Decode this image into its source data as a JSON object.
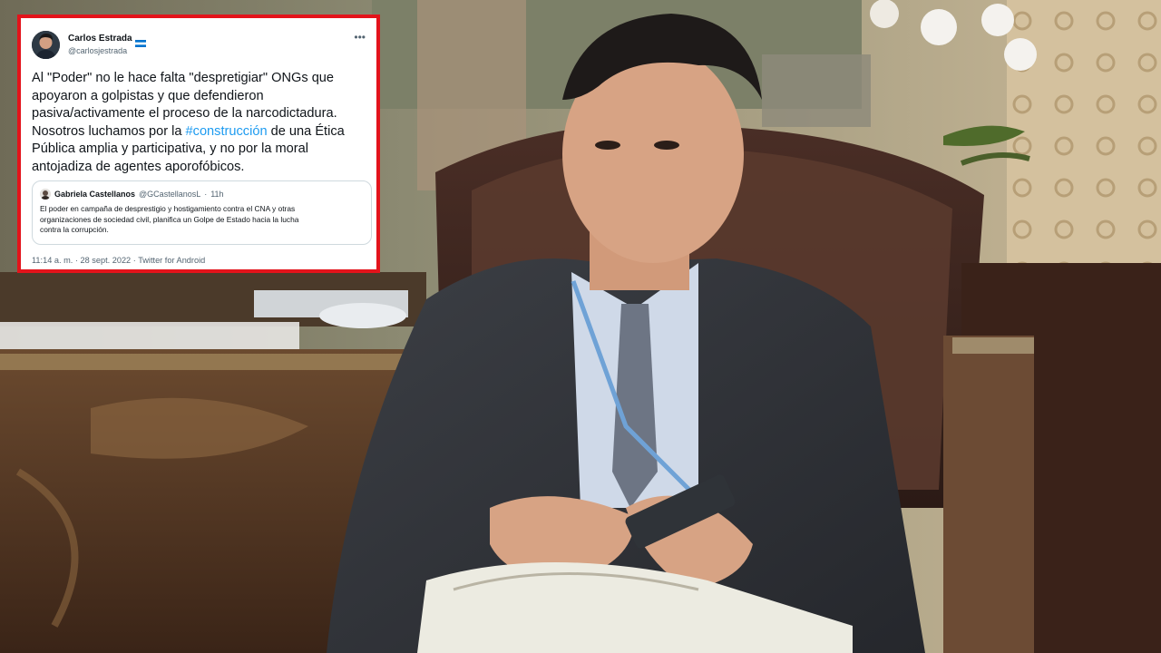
{
  "tweet": {
    "author_name": "Carlos Estrada",
    "author_handle": "@carlosjestrada",
    "more_label": "•••",
    "text_lines": [
      "Al \"Poder\" no le hace falta \"despretigiar\" ONGs que",
      "apoyaron a golpistas y que defendieron",
      "pasiva/activamente el proceso de la narcodictadura.",
      "Nosotros luchamos por la ",
      "#construcción",
      " de una Ética",
      "Pública amplia y participativa, y no por la moral",
      "antojadiza de agentes aporofóbicos."
    ],
    "quote": {
      "author_name": "Gabriela Castellanos",
      "author_handle": "@GCastellanosL",
      "separator": "·",
      "time": "11h",
      "text_lines": [
        "El poder en campaña de desprestigio y hostigamiento contra el CNA y otras",
        "organizaciones de sociedad civil, planifica un Golpe de Estado hacia la lucha",
        "contra la corrupción."
      ]
    },
    "time": "11:14 a. m.",
    "meta_separator": "·",
    "date": "28 sept. 2022",
    "source": "Twitter for Android"
  },
  "colors": {
    "frame_border": "#e3131b",
    "hashtag": "#1d9bf0",
    "secondary_text": "#536471",
    "quote_border": "#cfd9de"
  },
  "icons": {
    "more": "more-icon",
    "flag": "honduras-flag-icon"
  }
}
